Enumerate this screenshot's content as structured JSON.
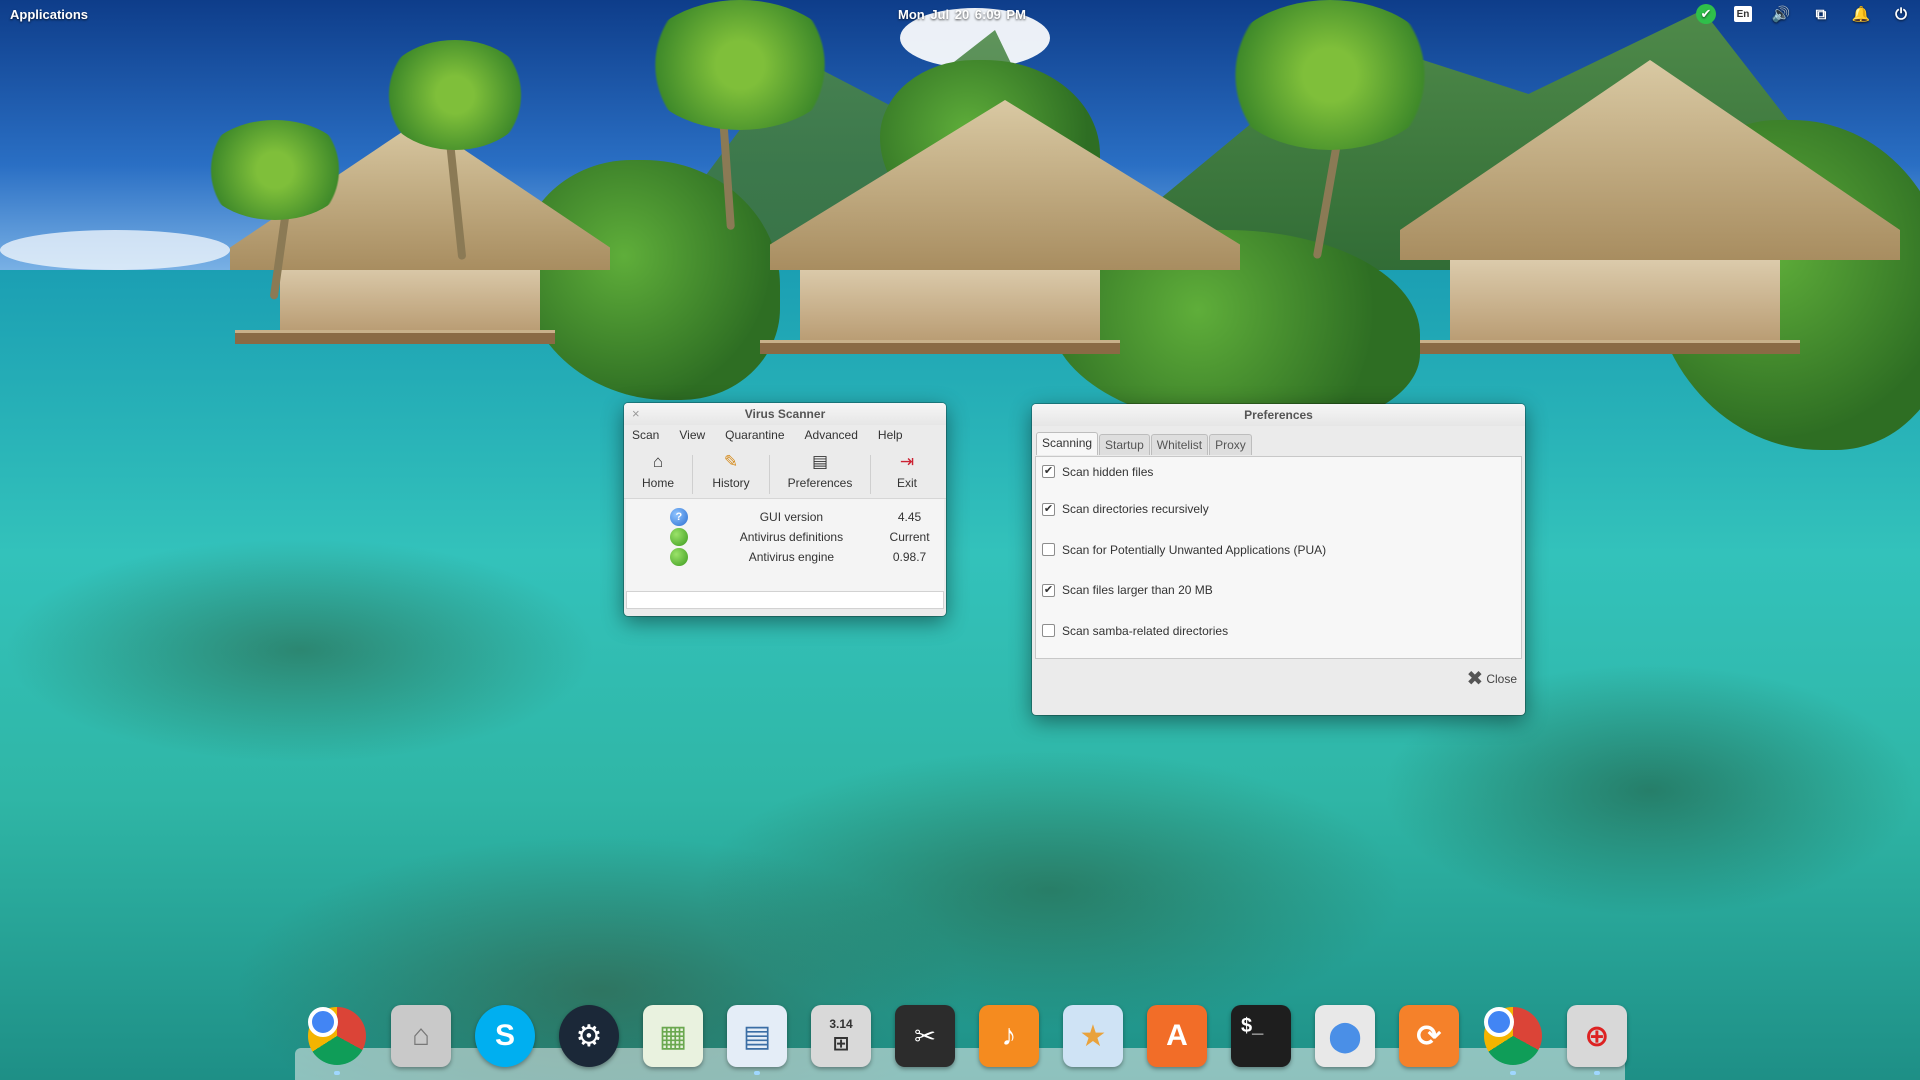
{
  "top_panel": {
    "applications_label": "Applications",
    "clock": "Mon Jul 20    6:09 PM",
    "keyboard_layout": "En"
  },
  "virus_scanner": {
    "title": "Virus Scanner",
    "menu": [
      "Scan",
      "View",
      "Quarantine",
      "Advanced",
      "Help"
    ],
    "toolbar": {
      "home": "Home",
      "history": "History",
      "preferences": "Preferences",
      "exit": "Exit"
    },
    "status": [
      {
        "label": "GUI version",
        "value": "4.45",
        "icon": "info-icon"
      },
      {
        "label": "Antivirus definitions",
        "value": "Current",
        "icon": "ok-icon"
      },
      {
        "label": "Antivirus engine",
        "value": "0.98.7",
        "icon": "ok-icon"
      }
    ]
  },
  "preferences": {
    "title": "Preferences",
    "tabs": [
      "Scanning",
      "Startup",
      "Whitelist",
      "Proxy"
    ],
    "active_tab": "Scanning",
    "options": [
      {
        "label": "Scan hidden files",
        "checked": true
      },
      {
        "label": "Scan directories recursively",
        "checked": true
      },
      {
        "label": "Scan for Potentially Unwanted Applications (PUA)",
        "checked": false
      },
      {
        "label": "Scan files larger than 20 MB",
        "checked": true
      },
      {
        "label": "Scan samba-related directories",
        "checked": false
      }
    ],
    "close_label": "Close"
  },
  "dock": {
    "items": [
      {
        "name": "chrome-icon",
        "color": "#ffffff"
      },
      {
        "name": "files-icon",
        "color": "#c9c9c9"
      },
      {
        "name": "skype-icon",
        "color": "#00aff0"
      },
      {
        "name": "steam-icon",
        "color": "#1b2838"
      },
      {
        "name": "spreadsheet-icon",
        "color": "#e9f2df"
      },
      {
        "name": "document-viewer-icon",
        "color": "#e4edf7"
      },
      {
        "name": "calculator-icon",
        "color": "#d9d9d9"
      },
      {
        "name": "screenshot-icon",
        "color": "#2c2c2c"
      },
      {
        "name": "music-icon",
        "color": "#f58b1f"
      },
      {
        "name": "photos-icon",
        "color": "#cfe3f5"
      },
      {
        "name": "app-center-icon",
        "color": "#f26d28"
      },
      {
        "name": "terminal-icon",
        "color": "#1e1e1e"
      },
      {
        "name": "settings-toggle-icon",
        "color": "#e8e8e8"
      },
      {
        "name": "update-icon",
        "color": "#f5812a"
      },
      {
        "name": "chrome-icon-2",
        "color": "#ffffff"
      },
      {
        "name": "virus-scanner-icon",
        "color": "#d8d8d8"
      }
    ],
    "terminal_glyph": "$_",
    "calculator_glyph": "3.14"
  }
}
